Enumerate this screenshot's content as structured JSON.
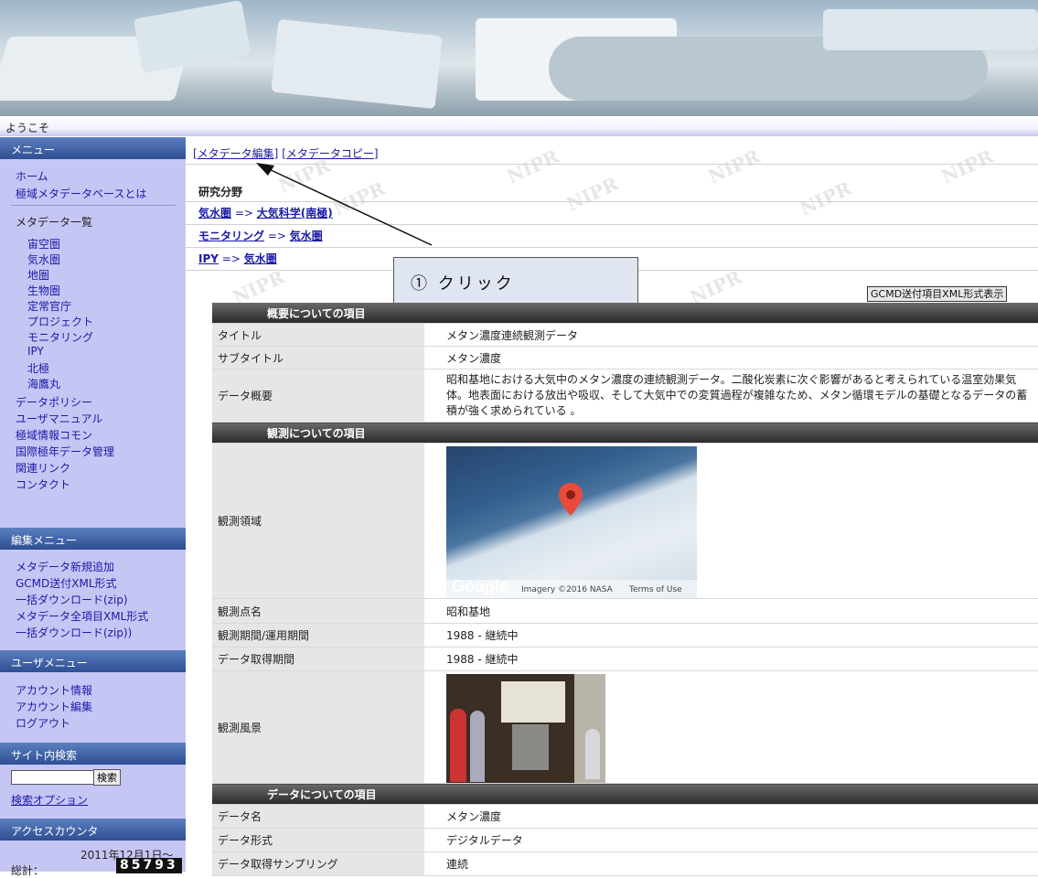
{
  "welcome": "ようこそ",
  "sidebar": {
    "menu_title": "メニュー",
    "home": "ホーム",
    "about": "極域メタデータベースとは",
    "list_title": "メタデータ一覧",
    "categories": [
      "宙空圏",
      "気水圏",
      "地圏",
      "生物圏",
      "定常官庁",
      "プロジェクト",
      "モニタリング",
      "IPY",
      "北極",
      "海鷹丸"
    ],
    "links": [
      "データポリシー",
      "ユーザマニュアル",
      "極域情報コモン",
      "国際極年データ管理",
      "関連リンク",
      "コンタクト"
    ],
    "edit_menu_title": "編集メニュー",
    "edit_items": [
      "メタデータ新規追加",
      "GCMD送付XML形式",
      "一括ダウンロード(zip)",
      "メタデータ全項目XML形式",
      "一括ダウンロード(zip))"
    ],
    "user_menu_title": "ユーザメニュー",
    "user_items": [
      "アカウント情報",
      "アカウント編集",
      "ログアウト"
    ],
    "search_title": "サイト内検索",
    "search_value": "",
    "search_button": "検索",
    "search_options": "検索オプション",
    "counter_title": "アクセスカウンタ",
    "counter_since": "2011年12月1日～",
    "counter_label": "総計：",
    "counter_value": "85793"
  },
  "main": {
    "edit_link": "[メタデータ編集]",
    "copy_link": "[メタデータコピー]",
    "research_field_label": "研究分野",
    "breadcrumbs": [
      {
        "from": "気水圏",
        "arrow": " => ",
        "to": "大気科学(南極)"
      },
      {
        "from": "モニタリング",
        "arrow": " => ",
        "to": "気水圏"
      },
      {
        "from": "IPY",
        "arrow": " => ",
        "to": "気水圏"
      }
    ],
    "callout": "① クリック",
    "xml_button": "GCMD送付項目XML形式表示",
    "watermark": "NIPR",
    "sections": {
      "overview": "概要についての項目",
      "observation": "観測についての項目",
      "data": "データについての項目"
    },
    "rows": {
      "title_k": "タイトル",
      "title_v": "メタン濃度連続観測データ",
      "subtitle_k": "サブタイトル",
      "subtitle_v": "メタン濃度",
      "summary_k": "データ概要",
      "summary_v": "昭和基地における大気中のメタン濃度の連続観測データ。二酸化炭素に次ぐ影響があると考えられている温室効果気体。地表面における放出や吸収、そして大気中での変質過程が複雑なため、メタン循環モデルの基礎となるデータの蓄積が強く求められている 。",
      "area_k": "観測領域",
      "station_k": "観測点名",
      "station_v": "昭和基地",
      "period_k": "観測期間/運用期間",
      "period_v": "1988 - 継続中",
      "acq_k": "データ取得期間",
      "acq_v": "1988 - 継続中",
      "scene_k": "観測風景",
      "dataname_k": "データ名",
      "dataname_v": "メタン濃度",
      "format_k": "データ形式",
      "format_v": "デジタルデータ",
      "sampling_k": "データ取得サンプリング",
      "sampling_v": "連続"
    },
    "map": {
      "logo": "Google",
      "imagery": "Imagery ©2016 NASA",
      "terms": "Terms of Use"
    }
  },
  "colors": {
    "sidebar_bg": "#c6c6f5",
    "sidebar_header": "#2e4f93",
    "section_header": "#3a3a3a",
    "link": "#1a1aa6",
    "callout_bg": "#dfe5f1"
  }
}
